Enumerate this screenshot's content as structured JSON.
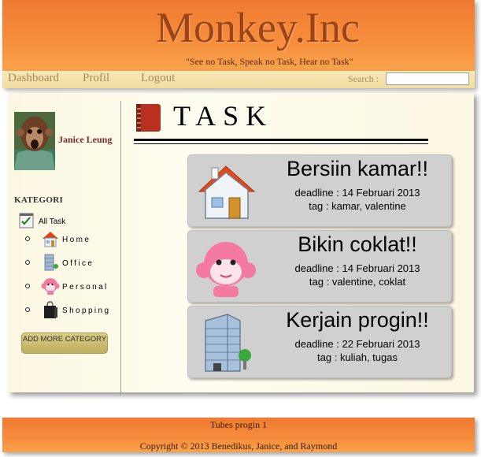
{
  "header": {
    "title": "Monkey.Inc",
    "tagline": "\"See no Task, Speak no Task, Hear no Task\""
  },
  "nav": {
    "items": [
      "Dashboard",
      "Profil",
      "Logout"
    ],
    "search_label": "Search  :",
    "search_value": ""
  },
  "user": {
    "name": "Janice Leung",
    "avatar_icon": "monkey-avatar-photo"
  },
  "sidebar": {
    "heading": "KATEGORI",
    "all_task": "All Task",
    "categories": [
      {
        "label": "Home",
        "icon": "home-icon"
      },
      {
        "label": "Office",
        "icon": "office-building-icon"
      },
      {
        "label": "Personal",
        "icon": "monkey-face-icon"
      },
      {
        "label": "Shopping",
        "icon": "shopping-bag-icon"
      }
    ],
    "add_button": "ADD MORE CATEGORY"
  },
  "main": {
    "title": "TASK",
    "title_icon": "book-icon",
    "tasks": [
      {
        "title": "Bersiin kamar!!",
        "deadline": "deadline : 14 Februari 2013",
        "tag": "tag : kamar, valentine",
        "icon": "home-icon"
      },
      {
        "title": "Bikin coklat!!",
        "deadline": "deadline : 14 Februari 2013",
        "tag": "tag : valentine, coklat",
        "icon": "monkey-face-icon"
      },
      {
        "title": "Kerjain progin!!",
        "deadline": "deadline : 22 Februari 2013",
        "tag": "tag : kuliah, tugas",
        "icon": "office-building-icon"
      }
    ]
  },
  "footer": {
    "line1": "Tubes progin 1",
    "line2": "Copyright © 2013 Benedikus, Janice, and Raymond"
  },
  "colors": {
    "header_orange": "#f07a30",
    "title_brown": "#9a4418",
    "nav_cream": "#f7e8b8",
    "nav_text": "#a58b5a",
    "card_gray": "#d0d0d0",
    "username_red": "#7a2a2a"
  }
}
